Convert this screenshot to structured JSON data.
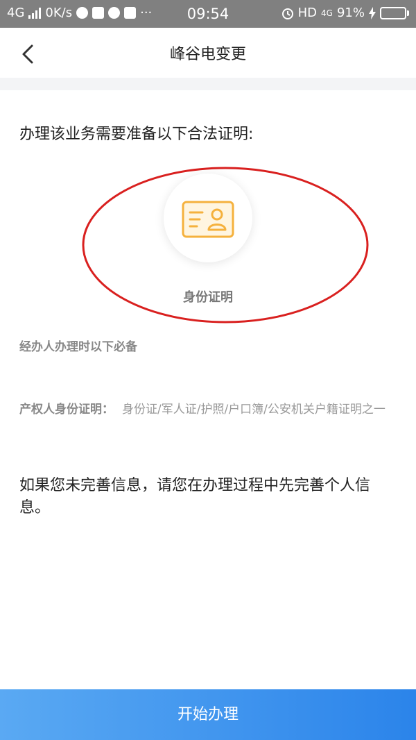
{
  "status_bar": {
    "network": "4G",
    "speed": "0K/s",
    "time": "09:54",
    "hd": "HD",
    "lte": "4G",
    "battery": "91%",
    "battery_level": 0.91,
    "icons": [
      "signal-icon",
      "browser-icon",
      "notification-icon",
      "music-icon",
      "mail-icon",
      "alarm-icon",
      "charging-icon",
      "battery-icon"
    ],
    "more": "···"
  },
  "nav": {
    "title": "峰谷电变更",
    "back_icon": "chevron-left-icon"
  },
  "intro": "办理该业务需要准备以下合法证明:",
  "document": {
    "icon": "id-card-icon",
    "label": "身份证明"
  },
  "requirement_title": "经办人办理时以下必备",
  "property_owner": {
    "label": "产权人身份证明：",
    "value": "身份证/军人证/护照/户口簿/公安机关户籍证明之一"
  },
  "notice": "如果您未完善信息，请您在办理过程中先完善个人信息。",
  "start_button": "开始办理",
  "colors": {
    "accent_blue": "#2b84ea",
    "icon_orange": "#f5b13d",
    "annotation_red": "#d9201f"
  }
}
